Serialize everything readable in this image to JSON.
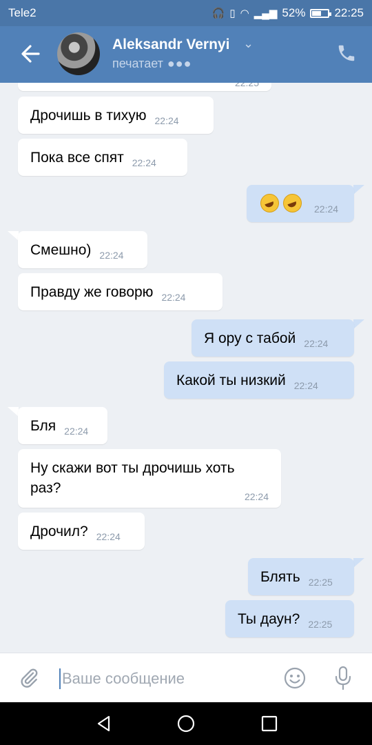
{
  "status_bar": {
    "carrier": "Tele2",
    "battery": "52%",
    "time": "22:25"
  },
  "header": {
    "contact_name": "Aleksandr Vernyi",
    "status": "печатает"
  },
  "messages": [
    {
      "dir": "in",
      "text": "",
      "time": "22:25"
    },
    {
      "dir": "in",
      "text": "Дрочишь в тихую",
      "time": "22:24"
    },
    {
      "dir": "in",
      "text": "Пока все спят",
      "time": "22:24"
    },
    {
      "dir": "out",
      "text": "",
      "emoji": [
        "rolling-on-floor-laughing",
        "rolling-on-floor-laughing"
      ],
      "time": "22:24"
    },
    {
      "dir": "in",
      "text": "Смешно)",
      "time": "22:24"
    },
    {
      "dir": "in",
      "text": "Правду же говорю",
      "time": "22:24"
    },
    {
      "dir": "out",
      "text": "Я ору с табой",
      "time": "22:24"
    },
    {
      "dir": "out",
      "text": "Какой ты низкий",
      "time": "22:24"
    },
    {
      "dir": "in",
      "text": "Бля",
      "time": "22:24"
    },
    {
      "dir": "in",
      "text": "Ну скажи вот ты дрочишь хоть раз?",
      "time": "22:24"
    },
    {
      "dir": "in",
      "text": "Дрочил?",
      "time": "22:24"
    },
    {
      "dir": "out",
      "text": "Блять",
      "time": "22:25"
    },
    {
      "dir": "out",
      "text": "Ты даун?",
      "time": "22:25"
    }
  ],
  "composer": {
    "placeholder": "Ваше сообщение",
    "value": ""
  },
  "colors": {
    "header": "#5181b8",
    "status_bar": "#4a76a8",
    "bubble_out": "#cfe0f6",
    "bubble_in": "#ffffff",
    "background": "#edf0f4"
  }
}
